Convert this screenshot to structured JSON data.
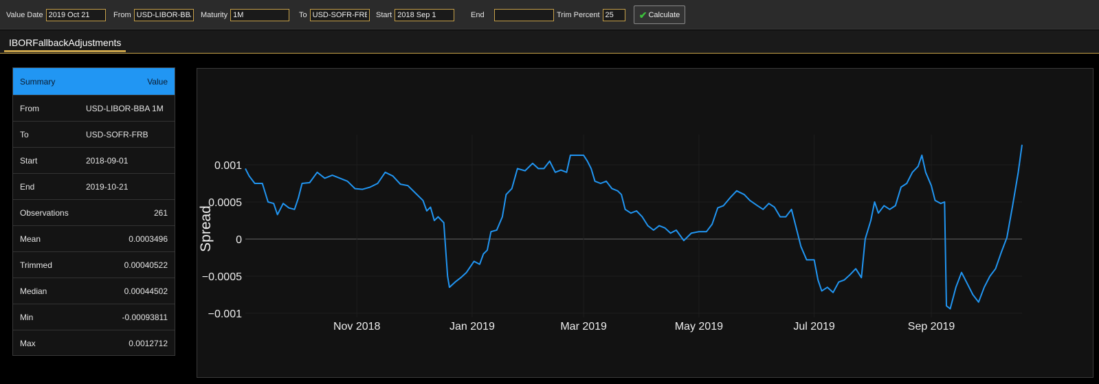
{
  "toolbar": {
    "value_date_label": "Value Date",
    "value_date": "2019 Oct 21",
    "from_label": "From",
    "from": "USD-LIBOR-BBA",
    "maturity_label": "Maturity",
    "maturity": "1M",
    "to_label": "To",
    "to": "USD-SOFR-FRB",
    "start_label": "Start",
    "start": "2018 Sep 1",
    "end_label": "End",
    "end": "",
    "trim_label": "Trim Percent",
    "trim": "25",
    "calculate_label": "Calculate"
  },
  "tabs": [
    {
      "label": "IBORFallbackAdjustments"
    }
  ],
  "summary": {
    "header_key": "Summary",
    "header_value": "Value",
    "rows": [
      {
        "key": "From",
        "value": "USD-LIBOR-BBA 1M"
      },
      {
        "key": "To",
        "value": "USD-SOFR-FRB"
      },
      {
        "key": "Start",
        "value": "2018-09-01"
      },
      {
        "key": "End",
        "value": "2019-10-21"
      },
      {
        "key": "Observations",
        "value": "261"
      },
      {
        "key": "Mean",
        "value": "0.0003496"
      },
      {
        "key": "Trimmed",
        "value": "0.00040522"
      },
      {
        "key": "Median",
        "value": "0.00044502"
      },
      {
        "key": "Min",
        "value": "-0.00093811"
      },
      {
        "key": "Max",
        "value": "0.0012712"
      }
    ]
  },
  "colors": {
    "accent": "#2196f3",
    "tab_underline": "#c8a24a",
    "line": "#2196f3"
  },
  "chart_data": {
    "type": "line",
    "title": "",
    "xlabel": "",
    "ylabel": "Spread",
    "ylim": [
      -0.0011,
      0.0014
    ],
    "y_ticks": [
      0.001,
      0.0005,
      0,
      -0.0005,
      -0.001
    ],
    "y_tick_labels": [
      "0.001",
      "0.0005",
      "0",
      "−0.0005",
      "−0.001"
    ],
    "x_ticks": [
      "2018-11-01",
      "2019-01-01",
      "2019-03-01",
      "2019-05-01",
      "2019-07-01",
      "2019-09-01"
    ],
    "x_tick_labels": [
      "Nov 2018",
      "Jan 2019",
      "Mar 2019",
      "May 2019",
      "Jul 2019",
      "Sep 2019"
    ],
    "grid": true,
    "series": [
      {
        "values": [
          [
            "2018-09-03",
            0.00095
          ],
          [
            "2018-09-05",
            0.00085
          ],
          [
            "2018-09-08",
            0.00075
          ],
          [
            "2018-09-12",
            0.00075
          ],
          [
            "2018-09-15",
            0.0005
          ],
          [
            "2018-09-18",
            0.00048
          ],
          [
            "2018-09-20",
            0.00033
          ],
          [
            "2018-09-23",
            0.00048
          ],
          [
            "2018-09-26",
            0.00042
          ],
          [
            "2018-09-29",
            0.0004
          ],
          [
            "2018-10-01",
            0.00055
          ],
          [
            "2018-10-03",
            0.00075
          ],
          [
            "2018-10-07",
            0.00076
          ],
          [
            "2018-10-11",
            0.0009
          ],
          [
            "2018-10-15",
            0.00082
          ],
          [
            "2018-10-19",
            0.00086
          ],
          [
            "2018-10-23",
            0.00082
          ],
          [
            "2018-10-27",
            0.00078
          ],
          [
            "2018-10-31",
            0.00068
          ],
          [
            "2018-11-04",
            0.00067
          ],
          [
            "2018-11-08",
            0.0007
          ],
          [
            "2018-11-12",
            0.00075
          ],
          [
            "2018-11-16",
            0.0009
          ],
          [
            "2018-11-20",
            0.00085
          ],
          [
            "2018-11-24",
            0.00074
          ],
          [
            "2018-11-28",
            0.00072
          ],
          [
            "2018-12-02",
            0.00062
          ],
          [
            "2018-12-06",
            0.00052
          ],
          [
            "2018-12-08",
            0.00038
          ],
          [
            "2018-12-10",
            0.00043
          ],
          [
            "2018-12-12",
            0.00025
          ],
          [
            "2018-12-14",
            0.0003
          ],
          [
            "2018-12-17",
            0.00022
          ],
          [
            "2018-12-19",
            -0.0005
          ],
          [
            "2018-12-20",
            -0.00065
          ],
          [
            "2018-12-23",
            -0.00058
          ],
          [
            "2018-12-26",
            -0.00052
          ],
          [
            "2018-12-29",
            -0.00045
          ],
          [
            "2019-01-02",
            -0.0003
          ],
          [
            "2019-01-05",
            -0.00034
          ],
          [
            "2019-01-07",
            -0.0002
          ],
          [
            "2019-01-09",
            -0.00015
          ],
          [
            "2019-01-11",
            0.0001
          ],
          [
            "2019-01-14",
            0.00012
          ],
          [
            "2019-01-17",
            0.0003
          ],
          [
            "2019-01-19",
            0.0006
          ],
          [
            "2019-01-22",
            0.00068
          ],
          [
            "2019-01-25",
            0.00095
          ],
          [
            "2019-01-29",
            0.00092
          ],
          [
            "2019-02-02",
            0.00102
          ],
          [
            "2019-02-05",
            0.00095
          ],
          [
            "2019-02-08",
            0.00095
          ],
          [
            "2019-02-11",
            0.00105
          ],
          [
            "2019-02-14",
            0.0009
          ],
          [
            "2019-02-17",
            0.00093
          ],
          [
            "2019-02-20",
            0.0009
          ],
          [
            "2019-02-22",
            0.00113
          ],
          [
            "2019-02-26",
            0.00113
          ],
          [
            "2019-03-01",
            0.00113
          ],
          [
            "2019-03-03",
            0.00105
          ],
          [
            "2019-03-05",
            0.00095
          ],
          [
            "2019-03-07",
            0.00078
          ],
          [
            "2019-03-10",
            0.00075
          ],
          [
            "2019-03-13",
            0.00078
          ],
          [
            "2019-03-16",
            0.00068
          ],
          [
            "2019-03-19",
            0.00065
          ],
          [
            "2019-03-21",
            0.0006
          ],
          [
            "2019-03-23",
            0.0004
          ],
          [
            "2019-03-26",
            0.00035
          ],
          [
            "2019-03-29",
            0.00038
          ],
          [
            "2019-04-01",
            0.0003
          ],
          [
            "2019-04-04",
            0.00018
          ],
          [
            "2019-04-07",
            0.00012
          ],
          [
            "2019-04-10",
            0.00018
          ],
          [
            "2019-04-13",
            0.00015
          ],
          [
            "2019-04-16",
            8e-05
          ],
          [
            "2019-04-19",
            0.00012
          ],
          [
            "2019-04-23",
            -2e-05
          ],
          [
            "2019-04-27",
            8e-05
          ],
          [
            "2019-05-01",
            0.0001
          ],
          [
            "2019-05-05",
            0.0001
          ],
          [
            "2019-05-08",
            0.0002
          ],
          [
            "2019-05-11",
            0.00042
          ],
          [
            "2019-05-14",
            0.00045
          ],
          [
            "2019-05-18",
            0.00057
          ],
          [
            "2019-05-21",
            0.00065
          ],
          [
            "2019-05-25",
            0.0006
          ],
          [
            "2019-05-28",
            0.00052
          ],
          [
            "2019-06-01",
            0.00045
          ],
          [
            "2019-06-04",
            0.0004
          ],
          [
            "2019-06-07",
            0.00048
          ],
          [
            "2019-06-10",
            0.00043
          ],
          [
            "2019-06-13",
            0.0003
          ],
          [
            "2019-06-16",
            0.0003
          ],
          [
            "2019-06-19",
            0.0004
          ],
          [
            "2019-06-21",
            0.0002
          ],
          [
            "2019-06-24",
            -0.0001
          ],
          [
            "2019-06-27",
            -0.00028
          ],
          [
            "2019-07-01",
            -0.00028
          ],
          [
            "2019-07-03",
            -0.00055
          ],
          [
            "2019-07-05",
            -0.0007
          ],
          [
            "2019-07-08",
            -0.00065
          ],
          [
            "2019-07-11",
            -0.00072
          ],
          [
            "2019-07-14",
            -0.00058
          ],
          [
            "2019-07-17",
            -0.00055
          ],
          [
            "2019-07-20",
            -0.00048
          ],
          [
            "2019-07-23",
            -0.0004
          ],
          [
            "2019-07-26",
            -0.00052
          ],
          [
            "2019-07-28",
            0.0
          ],
          [
            "2019-07-31",
            0.00025
          ],
          [
            "2019-08-02",
            0.0005
          ],
          [
            "2019-08-04",
            0.00035
          ],
          [
            "2019-08-07",
            0.00045
          ],
          [
            "2019-08-10",
            0.0004
          ],
          [
            "2019-08-13",
            0.00045
          ],
          [
            "2019-08-16",
            0.0007
          ],
          [
            "2019-08-19",
            0.00075
          ],
          [
            "2019-08-22",
            0.0009
          ],
          [
            "2019-08-25",
            0.00098
          ],
          [
            "2019-08-27",
            0.00113
          ],
          [
            "2019-08-29",
            0.0009
          ],
          [
            "2019-09-01",
            0.00072
          ],
          [
            "2019-09-03",
            0.00052
          ],
          [
            "2019-09-06",
            0.00048
          ],
          [
            "2019-09-08",
            0.0005
          ],
          [
            "2019-09-09",
            -0.0009
          ],
          [
            "2019-09-11",
            -0.00094
          ],
          [
            "2019-09-14",
            -0.00065
          ],
          [
            "2019-09-17",
            -0.00045
          ],
          [
            "2019-09-20",
            -0.0006
          ],
          [
            "2019-09-23",
            -0.00075
          ],
          [
            "2019-09-26",
            -0.00085
          ],
          [
            "2019-09-29",
            -0.00065
          ],
          [
            "2019-10-02",
            -0.0005
          ],
          [
            "2019-10-05",
            -0.0004
          ],
          [
            "2019-10-08",
            -0.00018
          ],
          [
            "2019-10-11",
            2e-05
          ],
          [
            "2019-10-14",
            0.00045
          ],
          [
            "2019-10-17",
            0.0009
          ],
          [
            "2019-10-19",
            0.00127
          ]
        ]
      }
    ]
  }
}
